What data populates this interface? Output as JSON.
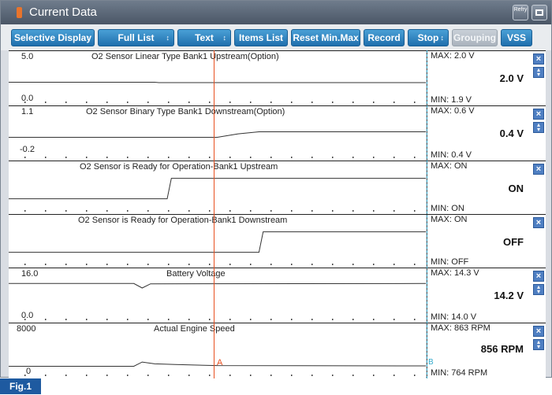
{
  "window": {
    "title": "Current Data",
    "refresh_label": "Refry"
  },
  "toolbar": [
    {
      "label": "Selective Display",
      "arrow": "↕",
      "enabled": true
    },
    {
      "label": "Full List",
      "arrow": "↕",
      "enabled": true
    },
    {
      "label": "Text",
      "arrow": "↕",
      "enabled": true
    },
    {
      "label": "Items List",
      "arrow": "↕",
      "enabled": true
    },
    {
      "label": "Reset Min.Max",
      "enabled": true
    },
    {
      "label": "Record",
      "enabled": true
    },
    {
      "label": "Stop",
      "arrow": "↕",
      "enabled": true
    },
    {
      "label": "Grouping",
      "enabled": false
    },
    {
      "label": "VSS",
      "enabled": true
    }
  ],
  "panels": [
    {
      "title": "O2 Sensor Linear Type Bank1 Upstream(Option)",
      "y_max": "5.0",
      "y_min": "0.0",
      "max": "MAX:   2.0 V",
      "min": "MIN:   1.9 V",
      "current": "2.0 V",
      "trace": [
        [
          0,
          0.42
        ],
        [
          0.35,
          0.42
        ],
        [
          0.36,
          0.41
        ],
        [
          1,
          0.41
        ]
      ]
    },
    {
      "title": "O2 Sensor Binary Type Bank1 Downstream(Option)",
      "y_max": "1.1",
      "y_min": "-0.2",
      "max": "MAX:   0.6 V",
      "min": "MIN:   0.4 V",
      "current": "0.4 V",
      "trace": [
        [
          0,
          0.42
        ],
        [
          0.5,
          0.42
        ],
        [
          0.55,
          0.52
        ],
        [
          0.6,
          0.58
        ],
        [
          1,
          0.58
        ]
      ]
    },
    {
      "title": "O2 Sensor is Ready for Operation-Bank1 Upstream",
      "y_max": "",
      "y_min": "",
      "max": "MAX: ON",
      "min": "MIN: ON",
      "current": "ON",
      "trace": [
        [
          0,
          0.2
        ],
        [
          0.38,
          0.2
        ],
        [
          0.39,
          0.82
        ],
        [
          1,
          0.82
        ]
      ]
    },
    {
      "title": "O2 Sensor is Ready for Operation-Bank1 Downstream",
      "y_max": "",
      "y_min": "",
      "max": "MAX: ON",
      "min": "MIN: OFF",
      "current": "OFF",
      "trace": [
        [
          0,
          0.2
        ],
        [
          0.6,
          0.2
        ],
        [
          0.61,
          0.82
        ],
        [
          1,
          0.82
        ]
      ]
    },
    {
      "title": "Battery Voltage",
      "y_max": "16.0",
      "y_min": "0.0",
      "max": "MAX:  14.3 V",
      "min": "MIN:  14.0 V",
      "current": "14.2 V",
      "trace": [
        [
          0,
          0.88
        ],
        [
          0.3,
          0.88
        ],
        [
          0.32,
          0.75
        ],
        [
          0.34,
          0.87
        ],
        [
          1,
          0.88
        ]
      ]
    },
    {
      "title": "Actual Engine Speed",
      "y_max": "8000",
      "y_min": "0",
      "max": "MAX:    863 RPM",
      "min": "MIN:   764 RPM",
      "current": "856 RPM",
      "trace": [
        [
          0,
          0.1
        ],
        [
          0.3,
          0.1
        ],
        [
          0.32,
          0.22
        ],
        [
          0.35,
          0.17
        ],
        [
          0.4,
          0.15
        ],
        [
          0.5,
          0.12
        ],
        [
          1,
          0.11
        ]
      ]
    }
  ],
  "cursors": {
    "a_label": "A",
    "b_label": "B"
  },
  "figure_label": "Fig.1"
}
